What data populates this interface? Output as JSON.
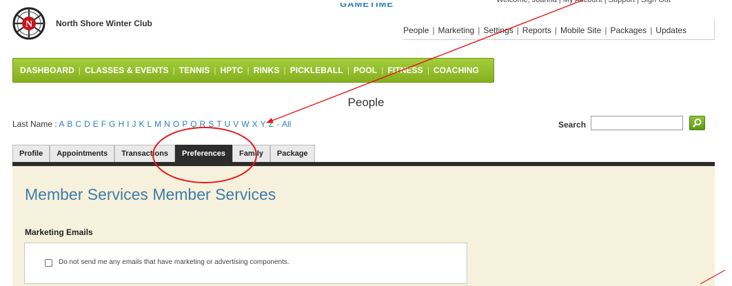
{
  "header": {
    "club_name": "North Shore Winter Club",
    "brand_partial": "GAMETIME",
    "top_links": "Welcome, Joanna  |  My Account  |  Support  |  Sign Out",
    "admin_nav": [
      "People",
      "Marketing",
      "Settings",
      "Reports",
      "Mobile Site",
      "Packages",
      "Updates"
    ]
  },
  "main_nav": [
    "DASHBOARD",
    "CLASSES & EVENTS",
    "TENNIS",
    "HPTC",
    "RINKS",
    "PICKLEBALL",
    "POOL",
    "FITNESS",
    "COACHING"
  ],
  "page": {
    "title": "People"
  },
  "alpha_filter": {
    "label": "Last Name :",
    "letters": [
      "A",
      "B",
      "C",
      "D",
      "E",
      "F",
      "G",
      "H",
      "I",
      "J",
      "K",
      "L",
      "M",
      "N",
      "O",
      "P",
      "Q",
      "R",
      "S",
      "T",
      "U",
      "V",
      "W",
      "X",
      "Y",
      "Z"
    ],
    "dash": "-",
    "all": "All"
  },
  "search": {
    "label": "Search",
    "value": ""
  },
  "tabs": [
    "Profile",
    "Appointments",
    "Transactions",
    "Preferences",
    "Family",
    "Package"
  ],
  "active_tab": "Preferences",
  "content": {
    "section_title": "Member Services Member Services",
    "marketing_heading": "Marketing Emails",
    "opt_out_label": "Do not send me any emails that have marketing or advertising components.",
    "opt_out_checked": false
  },
  "colors": {
    "nav_green": "#8fbd2a",
    "link_blue": "#2b7ec1",
    "annotation_red": "#e51919",
    "content_bg": "#f6f1dc"
  }
}
